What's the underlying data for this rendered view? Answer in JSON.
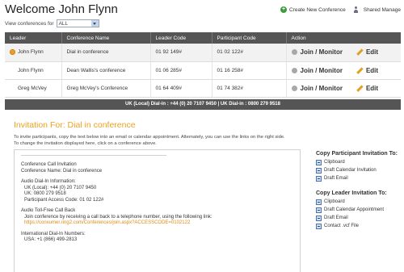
{
  "header": {
    "title": "Welcome John Flynn",
    "filter_label": "View conferences for",
    "filter_value": "ALL",
    "create_label": "Create New Conference",
    "shared_label": "Shared Manage"
  },
  "table": {
    "columns": [
      "Leader",
      "Conference Name",
      "Leader Code",
      "Participant Code",
      "Action"
    ],
    "rows": [
      {
        "leader": "John Flynn",
        "name": "Dial in conference",
        "leader_code": "01 92 149#",
        "participant_code": "01 02 122#",
        "monitor": "Join / Monitor",
        "edit": "Edit"
      },
      {
        "leader": "John Flynn",
        "name": "Dean Wallis's conference",
        "leader_code": "01 06 285#",
        "participant_code": "01 16 258#",
        "monitor": "Join / Monitor",
        "edit": "Edit"
      },
      {
        "leader": "Greg McVey",
        "name": "Greg McVey's Conference",
        "leader_code": "01 64 409#",
        "participant_code": "01 74 382#",
        "monitor": "Join / Monitor",
        "edit": "Edit"
      }
    ]
  },
  "dialin_bar": "UK (Local) Dial-in : +44 (0) 20 7107 9450 | UK Dial-in : 0800 279 9518",
  "invitation": {
    "title": "Invitation For: Dial in conference",
    "desc_line1": "To invite participants, copy the text below into an email or calendar appointment. Alternately, you can use the links on the right side.",
    "desc_line2": "To change the invitation displayed here, click on a conference above.",
    "lines": {
      "l1": "Conference Call Invitation",
      "l2": "Conference Name: Dial in conference",
      "l3": "Audio Dial-In Information:",
      "l4": "UK (Local): +44 (0) 20 7107 9450",
      "l5": "UK: 0800 279 9518",
      "l6": "Participant Access Code: 01 02 122#",
      "l7": "Audio Toll-Free Call Back",
      "l8": "Join conference by receiving a call back to a telephone number, using the following link:",
      "l9": "https://conxumer.ring2.com/Conferences/join.aspx?ACCESSCODE=0102122",
      "l10": "International Dial-In Numbers:",
      "l11": "USA: +1 (866) 499-2813"
    }
  },
  "participant_invite": {
    "heading": "Copy Participant Invitation To:",
    "options": [
      "Clipboard",
      "Draft Calendar Invitation",
      "Draft Email"
    ]
  },
  "leader_invite": {
    "heading": "Copy Leader Invitation To:",
    "options": [
      "Clipboard",
      "Draft Calendar Appointment",
      "Draft Email",
      "Contact .vcf File"
    ]
  },
  "colors": {
    "accent": "#f0a020",
    "header_bar": "#555555"
  }
}
